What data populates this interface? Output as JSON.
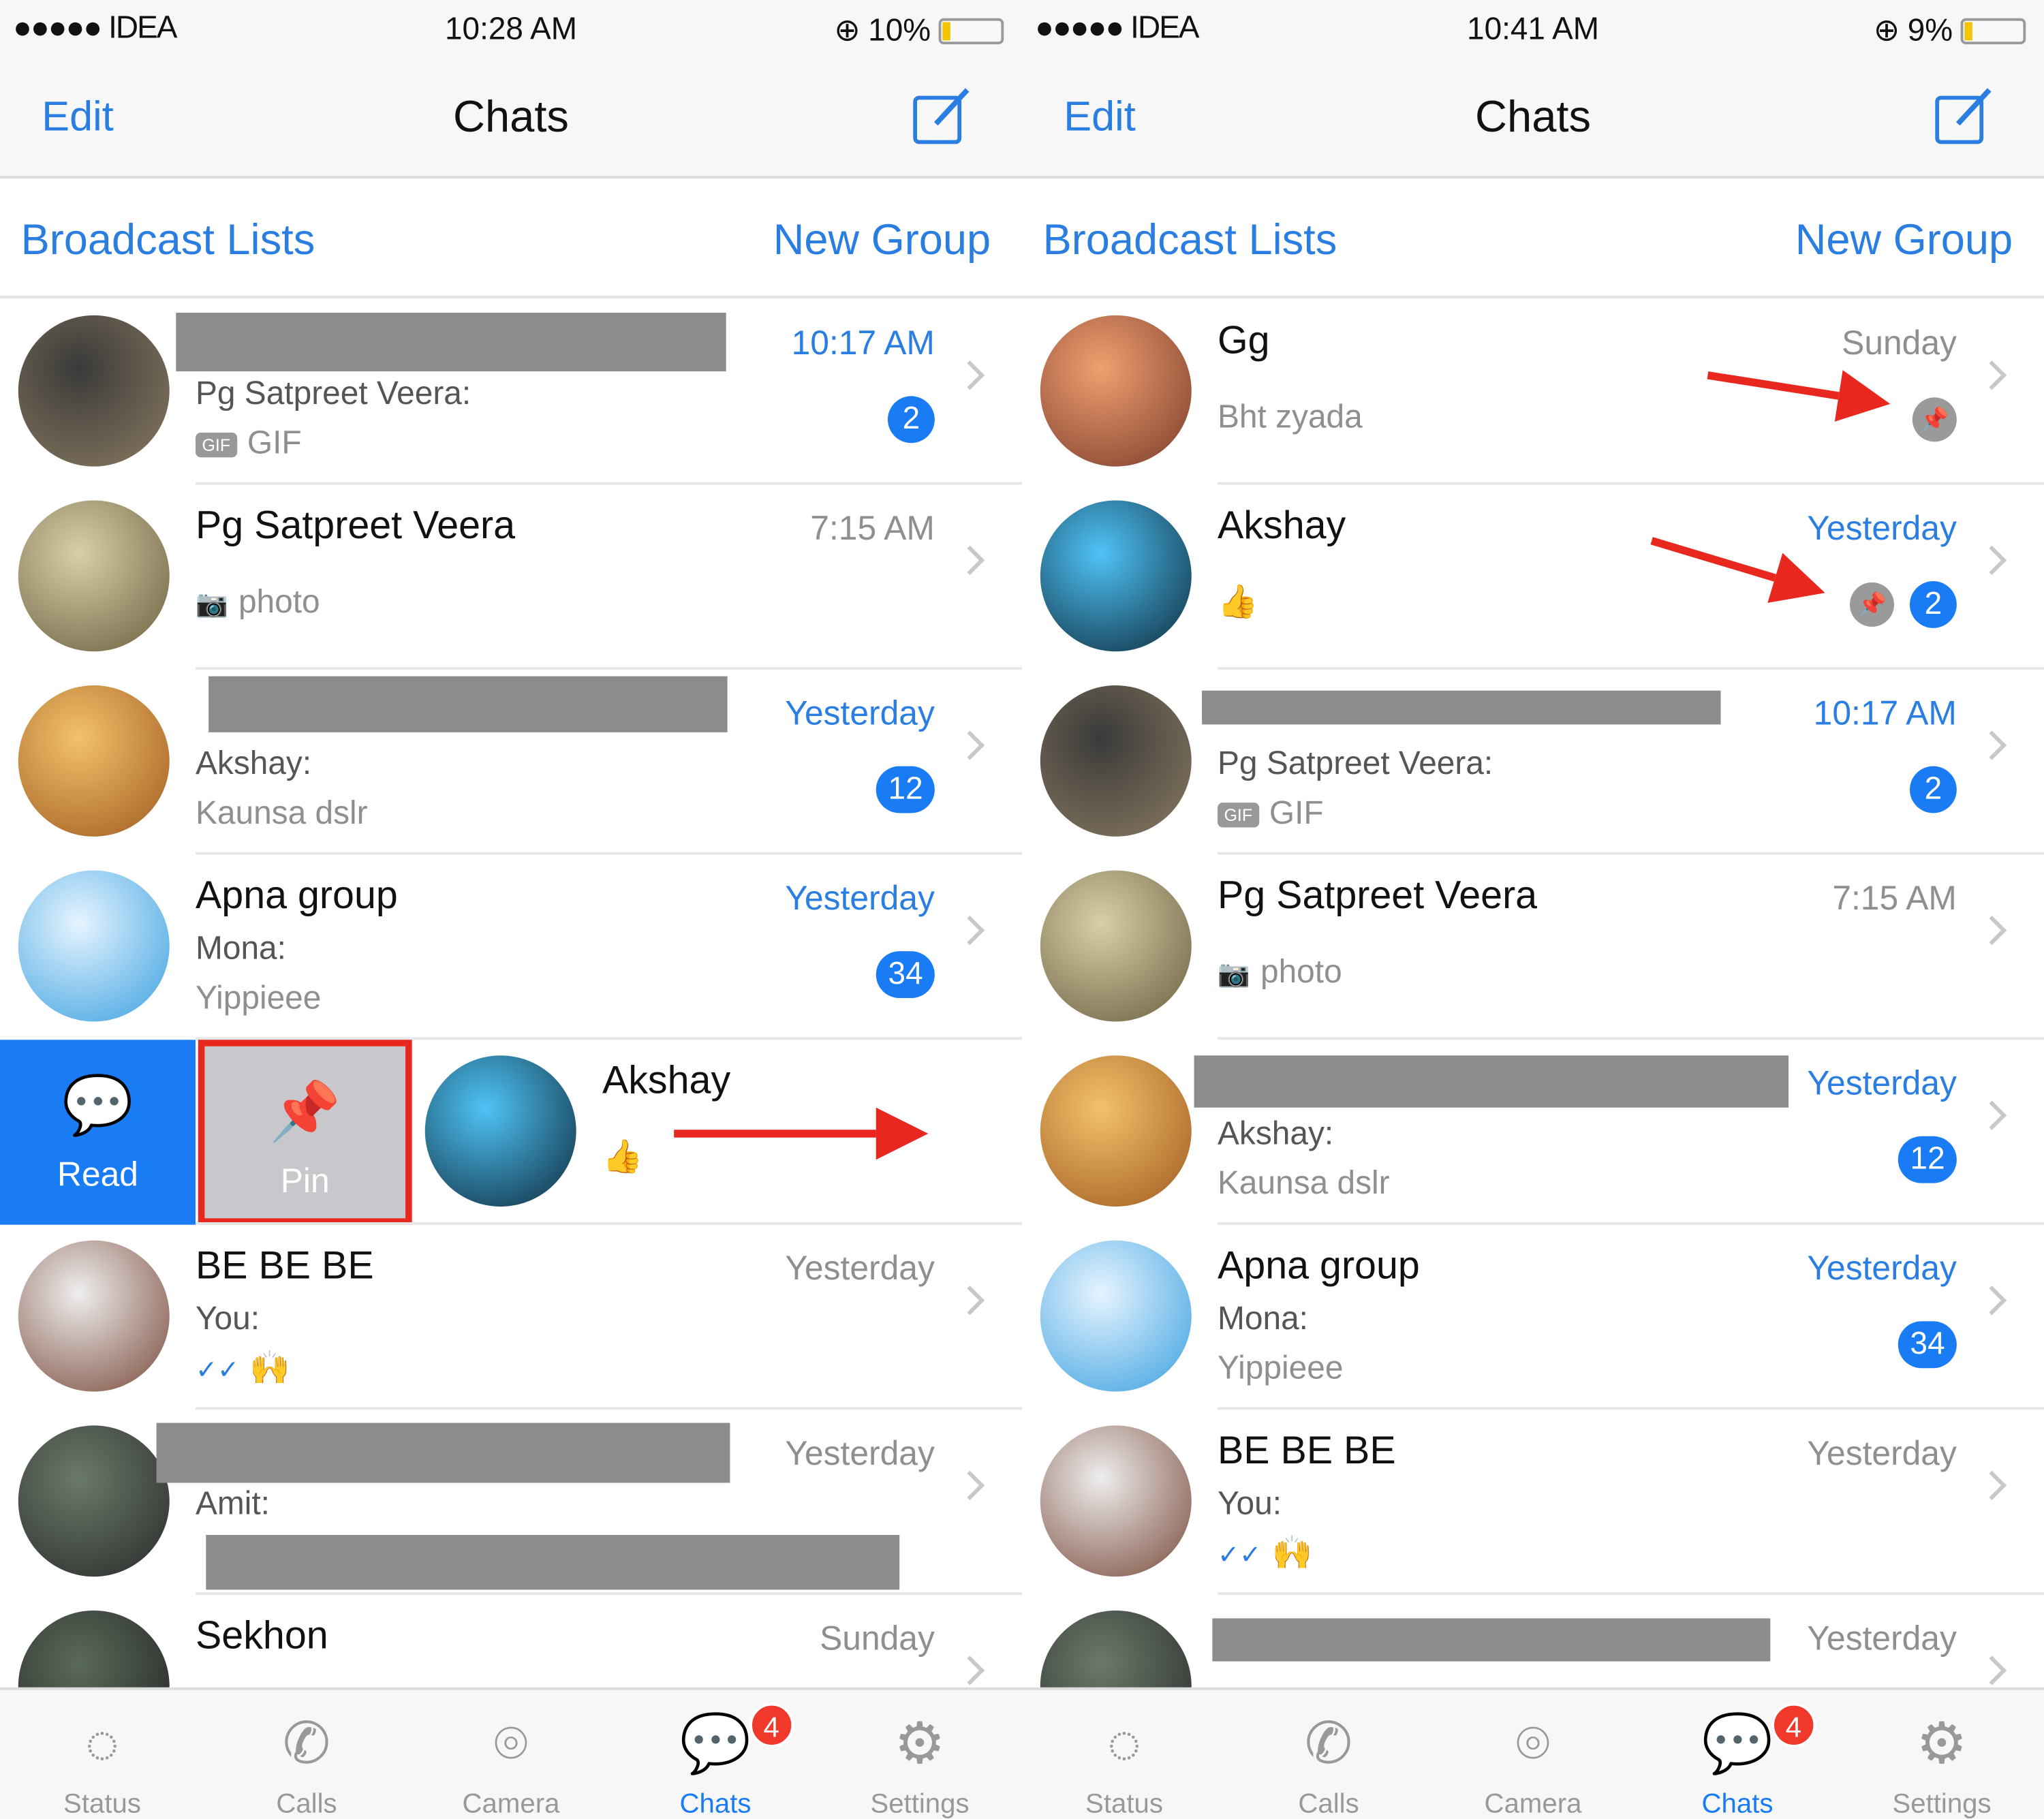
{
  "colors": {
    "accent": "#1a7cf5",
    "link": "#2a7de1",
    "annotation": "#e8281e",
    "badge_tab": "#f0392b"
  },
  "phones": [
    {
      "status": {
        "carrier": "●●●●● IDEA",
        "time": "10:28 AM",
        "battery": "10%",
        "battery_level": 0.1
      },
      "nav": {
        "edit": "Edit",
        "title": "Chats"
      },
      "links": {
        "broadcast": "Broadcast Lists",
        "new_group": "New Group"
      },
      "rows": [
        {
          "name": "",
          "redacted": true,
          "time": "10:17 AM",
          "unread": true,
          "line1": "Pg Satpreet Veera:",
          "line2": "GIF",
          "icon": "gif",
          "badge": "2",
          "av": [
            "#3a3a3a",
            "#8a7a60"
          ]
        },
        {
          "name": "Pg Satpreet Veera",
          "time": "7:15 AM",
          "line2": "photo",
          "icon": "camera",
          "av": [
            "#d8cfa8",
            "#6b5f3f"
          ]
        },
        {
          "name": "",
          "redacted": true,
          "time": "Yesterday",
          "unread": true,
          "line1": "Akshay:",
          "line2": "Kaunsa dslr",
          "badge": "12",
          "av": [
            "#f2c26b",
            "#a05a20"
          ]
        },
        {
          "name": "Apna group",
          "time": "Yesterday",
          "unread": true,
          "line1": "Mona:",
          "line2": "Yippieee",
          "badge": "34",
          "av": [
            "#e6f4ff",
            "#3aa0e0"
          ]
        },
        {
          "swiped": true,
          "name": "Akshay",
          "line2": "👍",
          "read_label": "Read",
          "pin_label": "Pin",
          "av": [
            "#4fc3f7",
            "#0d2a3a"
          ]
        },
        {
          "name": "BE BE BE",
          "time": "Yesterday",
          "line1": "You:",
          "line2": "🙌",
          "icon": "ticks",
          "av": [
            "#eee",
            "#7a4a3a"
          ]
        },
        {
          "name": "",
          "redacted": true,
          "time": "Yesterday",
          "line1": "Amit:",
          "line2": "",
          "av": [
            "#6a7a6a",
            "#2a2a2a"
          ]
        },
        {
          "name": "Sekhon",
          "time": "Sunday",
          "av": [
            "#5a6a5a",
            "#222"
          ]
        }
      ]
    },
    {
      "status": {
        "carrier": "●●●●● IDEA",
        "time": "10:41 AM",
        "battery": "9%",
        "battery_level": 0.09
      },
      "nav": {
        "edit": "Edit",
        "title": "Chats"
      },
      "links": {
        "broadcast": "Broadcast Lists",
        "new_group": "New Group"
      },
      "rows": [
        {
          "name": "Gg",
          "time": "Sunday",
          "line2": "Bht zyada",
          "pinned": true,
          "av": [
            "#f0a070",
            "#7a3a2a"
          ]
        },
        {
          "name": "Akshay",
          "time": "Yesterday",
          "unread": true,
          "line2": "👍",
          "pinned": true,
          "badge": "2",
          "av": [
            "#4fc3f7",
            "#0d2a3a"
          ]
        },
        {
          "name": "",
          "redacted": true,
          "time": "10:17 AM",
          "unread": true,
          "line1": "Pg Satpreet Veera:",
          "line2": "GIF",
          "icon": "gif",
          "badge": "2",
          "av": [
            "#3a3a3a",
            "#8a7a60"
          ]
        },
        {
          "name": "Pg Satpreet Veera",
          "time": "7:15 AM",
          "line2": "photo",
          "icon": "camera",
          "av": [
            "#d8cfa8",
            "#6b5f3f"
          ]
        },
        {
          "name": "",
          "redacted": true,
          "time": "Yesterday",
          "unread": true,
          "line1": "Akshay:",
          "line2": "Kaunsa dslr",
          "badge": "12",
          "av": [
            "#f2c26b",
            "#a05a20"
          ]
        },
        {
          "name": "Apna group",
          "time": "Yesterday",
          "unread": true,
          "line1": "Mona:",
          "line2": "Yippieee",
          "badge": "34",
          "av": [
            "#e6f4ff",
            "#3aa0e0"
          ]
        },
        {
          "name": "BE BE BE",
          "time": "Yesterday",
          "line1": "You:",
          "line2": "🙌",
          "icon": "ticks",
          "av": [
            "#eee",
            "#7a4a3a"
          ]
        },
        {
          "name": "",
          "redacted": true,
          "time": "Yesterday",
          "av": [
            "#6a7a6a",
            "#2a2a2a"
          ]
        }
      ]
    }
  ],
  "tabbar": {
    "items": [
      {
        "label": "Status",
        "icon": "status-icon",
        "glyph": "◌"
      },
      {
        "label": "Calls",
        "icon": "phone-icon",
        "glyph": "✆"
      },
      {
        "label": "Camera",
        "icon": "camera-icon",
        "glyph": "⌾"
      },
      {
        "label": "Chats",
        "icon": "chat-bubbles-icon",
        "glyph": "💬",
        "active": true,
        "badge": "4"
      },
      {
        "label": "Settings",
        "icon": "gear-icon",
        "glyph": "⚙"
      }
    ]
  }
}
